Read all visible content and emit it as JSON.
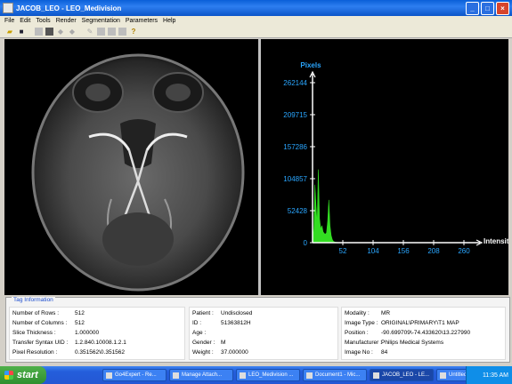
{
  "window": {
    "title": "JACOB_LEO - LEO_Medivision"
  },
  "menu": [
    "File",
    "Edit",
    "Tools",
    "Render",
    "Segmentation",
    "Parameters",
    "Help"
  ],
  "toolbar_icons": [
    "open-folder-icon",
    "save-icon",
    "tool-icon",
    "film-icon",
    "tool-icon",
    "tool-icon",
    "pencil-icon",
    "tool-icon",
    "tool-icon",
    "tool-icon",
    "help-icon"
  ],
  "chart_data": {
    "type": "area",
    "ylabel": "Pixels",
    "xlabel": "Intensity",
    "yticks": [
      0,
      52428,
      104857,
      157286,
      209715,
      262144
    ],
    "xticks": [
      52,
      104,
      156,
      208,
      260
    ],
    "xlim": [
      0,
      260
    ],
    "ylim": [
      0,
      262144
    ],
    "colors": {
      "fill": "#33dd22",
      "axis": "#ffffff",
      "ticks": "#2aa6ff"
    },
    "x": [
      0,
      2,
      4,
      6,
      8,
      10,
      12,
      14,
      16,
      18,
      20,
      22,
      24,
      26,
      28,
      30,
      32,
      34,
      36,
      40,
      44,
      48,
      52,
      60,
      70,
      80,
      100,
      130,
      180,
      260
    ],
    "y": [
      25000,
      12000,
      95000,
      60000,
      30000,
      120000,
      40000,
      22000,
      28000,
      18000,
      15000,
      14000,
      16000,
      35000,
      70000,
      28000,
      12000,
      5000,
      2000,
      600,
      300,
      150,
      80,
      40,
      20,
      10,
      5,
      2,
      0,
      0
    ]
  },
  "tag_info": {
    "legend": "Tag Information",
    "col1": [
      {
        "k": "Number of Rows :",
        "v": "512"
      },
      {
        "k": "Number of Columns :",
        "v": "512"
      },
      {
        "k": "Slice Thickness :",
        "v": "1.000000"
      },
      {
        "k": "Transfer Syntax UID :",
        "v": "1.2.840.10008.1.2.1"
      },
      {
        "k": "Pixel Resolution :",
        "v": "0.351562\\0.351562"
      }
    ],
    "col2": [
      {
        "k": "Patient :",
        "v": "Undisclosed"
      },
      {
        "k": "ID :",
        "v": "51363812H"
      },
      {
        "k": "Age :",
        "v": ""
      },
      {
        "k": "Gender :",
        "v": "M"
      },
      {
        "k": "Weight :",
        "v": "37.000000"
      }
    ],
    "col3": [
      {
        "k": "Modality :",
        "v": "MR"
      },
      {
        "k": "Image Type :",
        "v": "ORIGINAL\\PRIMARY\\T1 MAP"
      },
      {
        "k": "Position :",
        "v": "-90.699709\\-74.433620\\13.227990"
      },
      {
        "k": "Manufacturer :",
        "v": "Philips Medical Systems"
      },
      {
        "k": "Image No :",
        "v": "84"
      }
    ]
  },
  "taskbar": {
    "start_label": "start",
    "tasks": [
      "Go4Expert - Re...",
      "Manage Attach...",
      "LEO_Medivision ...",
      "Document1 - Mic...",
      "JACOB_LEO - LE...",
      "Untitled - Paint"
    ],
    "active_index": 4,
    "clock": "11:35 AM"
  }
}
